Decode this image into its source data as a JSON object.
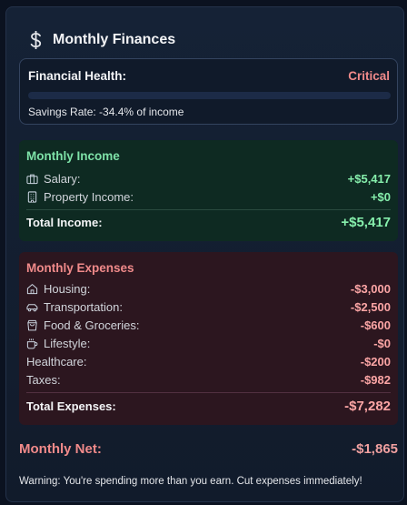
{
  "header": {
    "icon": "dollar-icon",
    "title": "Monthly Finances"
  },
  "health": {
    "label": "Financial Health:",
    "status": "Critical",
    "status_color": "#f08a8a",
    "bar_fill_fraction": 0,
    "savings_rate": "Savings Rate: -34.4% of income"
  },
  "income": {
    "title": "Monthly Income",
    "items": [
      {
        "icon": "briefcase-icon",
        "label": "Salary:",
        "amount": "+$5,417"
      },
      {
        "icon": "building-icon",
        "label": "Property Income:",
        "amount": "+$0"
      }
    ],
    "total_label": "Total Income:",
    "total_value": "+$5,417",
    "accent": "#86efac"
  },
  "expenses": {
    "title": "Monthly Expenses",
    "items": [
      {
        "icon": "home-icon",
        "label": "Housing:",
        "amount": "-$3,000"
      },
      {
        "icon": "car-icon",
        "label": "Transportation:",
        "amount": "-$2,500"
      },
      {
        "icon": "shopping-bag-icon",
        "label": "Food & Groceries:",
        "amount": "-$600"
      },
      {
        "icon": "coffee-icon",
        "label": "Lifestyle:",
        "amount": "-$0"
      },
      {
        "icon": "",
        "label": "Healthcare:",
        "amount": "-$200"
      },
      {
        "icon": "",
        "label": "Taxes:",
        "amount": "-$982"
      }
    ],
    "total_label": "Total Expenses:",
    "total_value": "-$7,282",
    "accent": "#fca5a5"
  },
  "net": {
    "label": "Monthly Net:",
    "value": "-$1,865"
  },
  "warning": "Warning: You're spending more than you earn. Cut expenses immediately!"
}
